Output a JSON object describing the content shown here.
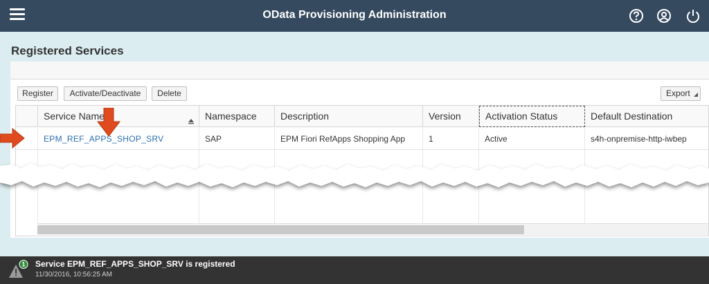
{
  "header": {
    "title": "OData Provisioning Administration",
    "icons": [
      "menu-icon",
      "help-icon",
      "user-icon",
      "power-icon"
    ]
  },
  "page": {
    "title": "Registered Services"
  },
  "toolbar": {
    "register": "Register",
    "activate": "Activate/Deactivate",
    "delete": "Delete",
    "export": "Export"
  },
  "table": {
    "columns": [
      "Service Name",
      "Namespace",
      "Description",
      "Version",
      "Activation Status",
      "Default Destination"
    ],
    "rows": [
      {
        "service_name": "EPM_REF_APPS_SHOP_SRV",
        "namespace": "SAP",
        "description": "EPM Fiori RefApps Shopping App",
        "version": "1",
        "status": "Active",
        "destination": "s4h-onpremise-http-iwbep"
      }
    ]
  },
  "message": {
    "count": "1",
    "text": "Service EPM_REF_APPS_SHOP_SRV is registered",
    "timestamp": "11/30/2016, 10:56:25 AM"
  },
  "colors": {
    "shell": "#354a5f",
    "background": "#dcedf1",
    "link": "#2a6eb3",
    "arrow": "#e04a1f",
    "message_bar": "#333333",
    "badge": "#2e8b3a"
  }
}
